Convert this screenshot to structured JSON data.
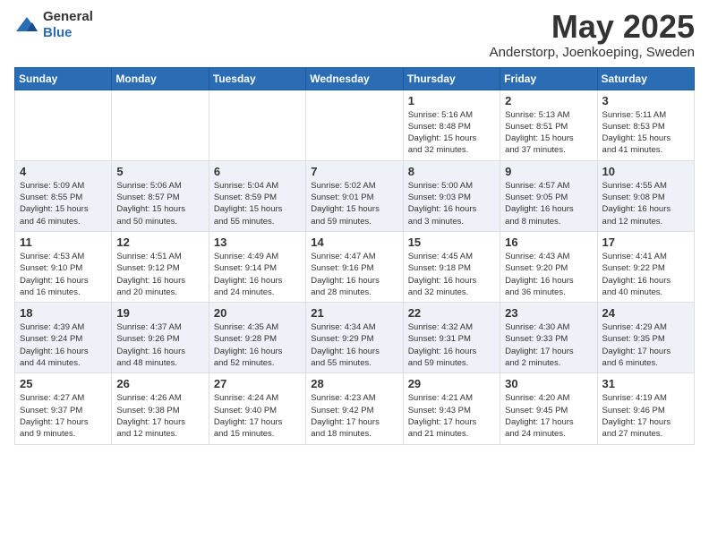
{
  "logo": {
    "general": "General",
    "blue": "Blue"
  },
  "header": {
    "title": "May 2025",
    "subtitle": "Anderstorp, Joenkoeping, Sweden"
  },
  "weekdays": [
    "Sunday",
    "Monday",
    "Tuesday",
    "Wednesday",
    "Thursday",
    "Friday",
    "Saturday"
  ],
  "weeks": [
    {
      "days": [
        {
          "num": "",
          "info": ""
        },
        {
          "num": "",
          "info": ""
        },
        {
          "num": "",
          "info": ""
        },
        {
          "num": "",
          "info": ""
        },
        {
          "num": "1",
          "info": "Sunrise: 5:16 AM\nSunset: 8:48 PM\nDaylight: 15 hours\nand 32 minutes."
        },
        {
          "num": "2",
          "info": "Sunrise: 5:13 AM\nSunset: 8:51 PM\nDaylight: 15 hours\nand 37 minutes."
        },
        {
          "num": "3",
          "info": "Sunrise: 5:11 AM\nSunset: 8:53 PM\nDaylight: 15 hours\nand 41 minutes."
        }
      ]
    },
    {
      "days": [
        {
          "num": "4",
          "info": "Sunrise: 5:09 AM\nSunset: 8:55 PM\nDaylight: 15 hours\nand 46 minutes."
        },
        {
          "num": "5",
          "info": "Sunrise: 5:06 AM\nSunset: 8:57 PM\nDaylight: 15 hours\nand 50 minutes."
        },
        {
          "num": "6",
          "info": "Sunrise: 5:04 AM\nSunset: 8:59 PM\nDaylight: 15 hours\nand 55 minutes."
        },
        {
          "num": "7",
          "info": "Sunrise: 5:02 AM\nSunset: 9:01 PM\nDaylight: 15 hours\nand 59 minutes."
        },
        {
          "num": "8",
          "info": "Sunrise: 5:00 AM\nSunset: 9:03 PM\nDaylight: 16 hours\nand 3 minutes."
        },
        {
          "num": "9",
          "info": "Sunrise: 4:57 AM\nSunset: 9:05 PM\nDaylight: 16 hours\nand 8 minutes."
        },
        {
          "num": "10",
          "info": "Sunrise: 4:55 AM\nSunset: 9:08 PM\nDaylight: 16 hours\nand 12 minutes."
        }
      ]
    },
    {
      "days": [
        {
          "num": "11",
          "info": "Sunrise: 4:53 AM\nSunset: 9:10 PM\nDaylight: 16 hours\nand 16 minutes."
        },
        {
          "num": "12",
          "info": "Sunrise: 4:51 AM\nSunset: 9:12 PM\nDaylight: 16 hours\nand 20 minutes."
        },
        {
          "num": "13",
          "info": "Sunrise: 4:49 AM\nSunset: 9:14 PM\nDaylight: 16 hours\nand 24 minutes."
        },
        {
          "num": "14",
          "info": "Sunrise: 4:47 AM\nSunset: 9:16 PM\nDaylight: 16 hours\nand 28 minutes."
        },
        {
          "num": "15",
          "info": "Sunrise: 4:45 AM\nSunset: 9:18 PM\nDaylight: 16 hours\nand 32 minutes."
        },
        {
          "num": "16",
          "info": "Sunrise: 4:43 AM\nSunset: 9:20 PM\nDaylight: 16 hours\nand 36 minutes."
        },
        {
          "num": "17",
          "info": "Sunrise: 4:41 AM\nSunset: 9:22 PM\nDaylight: 16 hours\nand 40 minutes."
        }
      ]
    },
    {
      "days": [
        {
          "num": "18",
          "info": "Sunrise: 4:39 AM\nSunset: 9:24 PM\nDaylight: 16 hours\nand 44 minutes."
        },
        {
          "num": "19",
          "info": "Sunrise: 4:37 AM\nSunset: 9:26 PM\nDaylight: 16 hours\nand 48 minutes."
        },
        {
          "num": "20",
          "info": "Sunrise: 4:35 AM\nSunset: 9:28 PM\nDaylight: 16 hours\nand 52 minutes."
        },
        {
          "num": "21",
          "info": "Sunrise: 4:34 AM\nSunset: 9:29 PM\nDaylight: 16 hours\nand 55 minutes."
        },
        {
          "num": "22",
          "info": "Sunrise: 4:32 AM\nSunset: 9:31 PM\nDaylight: 16 hours\nand 59 minutes."
        },
        {
          "num": "23",
          "info": "Sunrise: 4:30 AM\nSunset: 9:33 PM\nDaylight: 17 hours\nand 2 minutes."
        },
        {
          "num": "24",
          "info": "Sunrise: 4:29 AM\nSunset: 9:35 PM\nDaylight: 17 hours\nand 6 minutes."
        }
      ]
    },
    {
      "days": [
        {
          "num": "25",
          "info": "Sunrise: 4:27 AM\nSunset: 9:37 PM\nDaylight: 17 hours\nand 9 minutes."
        },
        {
          "num": "26",
          "info": "Sunrise: 4:26 AM\nSunset: 9:38 PM\nDaylight: 17 hours\nand 12 minutes."
        },
        {
          "num": "27",
          "info": "Sunrise: 4:24 AM\nSunset: 9:40 PM\nDaylight: 17 hours\nand 15 minutes."
        },
        {
          "num": "28",
          "info": "Sunrise: 4:23 AM\nSunset: 9:42 PM\nDaylight: 17 hours\nand 18 minutes."
        },
        {
          "num": "29",
          "info": "Sunrise: 4:21 AM\nSunset: 9:43 PM\nDaylight: 17 hours\nand 21 minutes."
        },
        {
          "num": "30",
          "info": "Sunrise: 4:20 AM\nSunset: 9:45 PM\nDaylight: 17 hours\nand 24 minutes."
        },
        {
          "num": "31",
          "info": "Sunrise: 4:19 AM\nSunset: 9:46 PM\nDaylight: 17 hours\nand 27 minutes."
        }
      ]
    }
  ]
}
